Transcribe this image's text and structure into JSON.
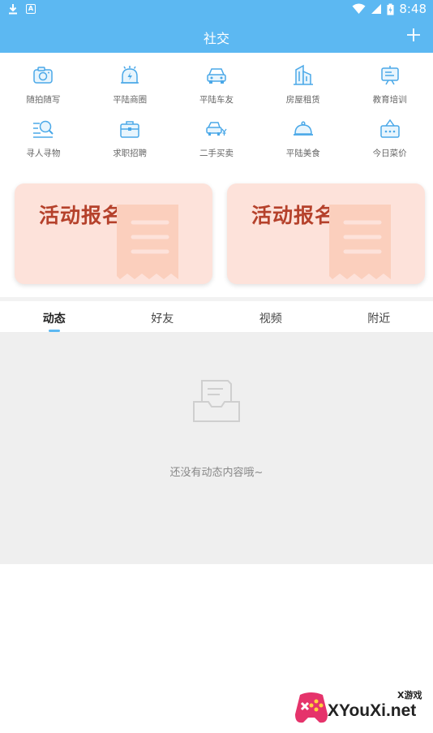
{
  "status_bar": {
    "time": "8:48",
    "badge": "A"
  },
  "header": {
    "title": "社交"
  },
  "grid": [
    [
      {
        "label": "随拍随写",
        "icon": "camera-icon"
      },
      {
        "label": "平陆商圈",
        "icon": "shop-bell-icon"
      },
      {
        "label": "平陆车友",
        "icon": "car-icon"
      },
      {
        "label": "房屋租赁",
        "icon": "building-icon"
      },
      {
        "label": "教育培训",
        "icon": "board-icon"
      }
    ],
    [
      {
        "label": "寻人寻物",
        "icon": "search-list-icon"
      },
      {
        "label": "求职招聘",
        "icon": "briefcase-icon"
      },
      {
        "label": "二手买卖",
        "icon": "car-yen-icon"
      },
      {
        "label": "平陆美食",
        "icon": "food-cloche-icon"
      },
      {
        "label": "今日菜价",
        "icon": "basket-icon"
      }
    ]
  ],
  "banners": [
    {
      "title": "活动报名"
    },
    {
      "title": "活动报名"
    }
  ],
  "tabs": [
    {
      "label": "动态",
      "active": true
    },
    {
      "label": "好友",
      "active": false
    },
    {
      "label": "视频",
      "active": false
    },
    {
      "label": "附近",
      "active": false
    }
  ],
  "empty_state": {
    "message": "还没有动态内容哦~"
  },
  "watermark": {
    "site": "XYouXi.net",
    "sub": "X游戏"
  },
  "colors": {
    "primary": "#5cb8f2",
    "banner_bg": "#fde2da",
    "banner_text": "#b5412b"
  }
}
